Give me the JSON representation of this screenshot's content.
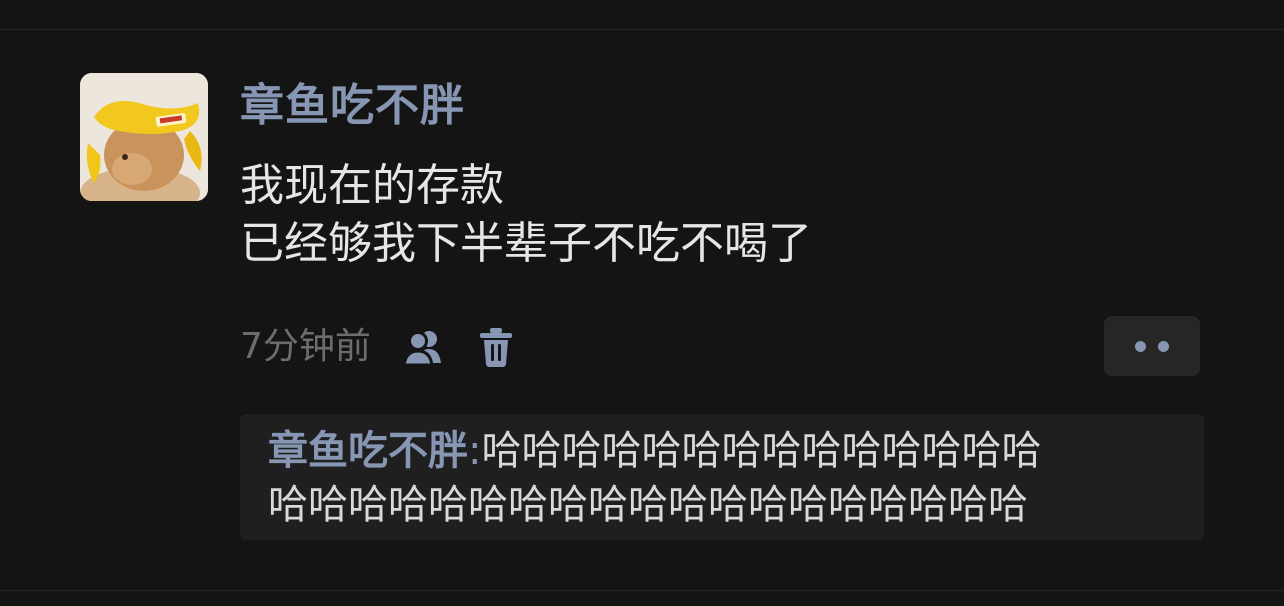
{
  "comment": {
    "username": "章鱼吃不胖",
    "content_lines": [
      "我现在的存款",
      "已经够我下半辈子不吃不喝了"
    ],
    "time": "7分钟前",
    "avatar_icon": "rabbit-banana-hat-avatar"
  },
  "actions": {
    "friends_icon": "friends-icon",
    "delete_icon": "trash-icon",
    "more_icon": "more-dots-icon"
  },
  "reply": {
    "author": "章鱼吃不胖",
    "separator": ":",
    "text_line1": "哈哈哈哈哈哈哈哈哈哈哈哈哈哈",
    "text_line2": "哈哈哈哈哈哈哈哈哈哈哈哈哈哈哈哈哈哈哈"
  },
  "colors": {
    "background": "#141414",
    "username": "#8796b3",
    "text": "#e6e6e6",
    "muted": "#6d6d6d",
    "reply_bg": "#1f1f1f"
  }
}
